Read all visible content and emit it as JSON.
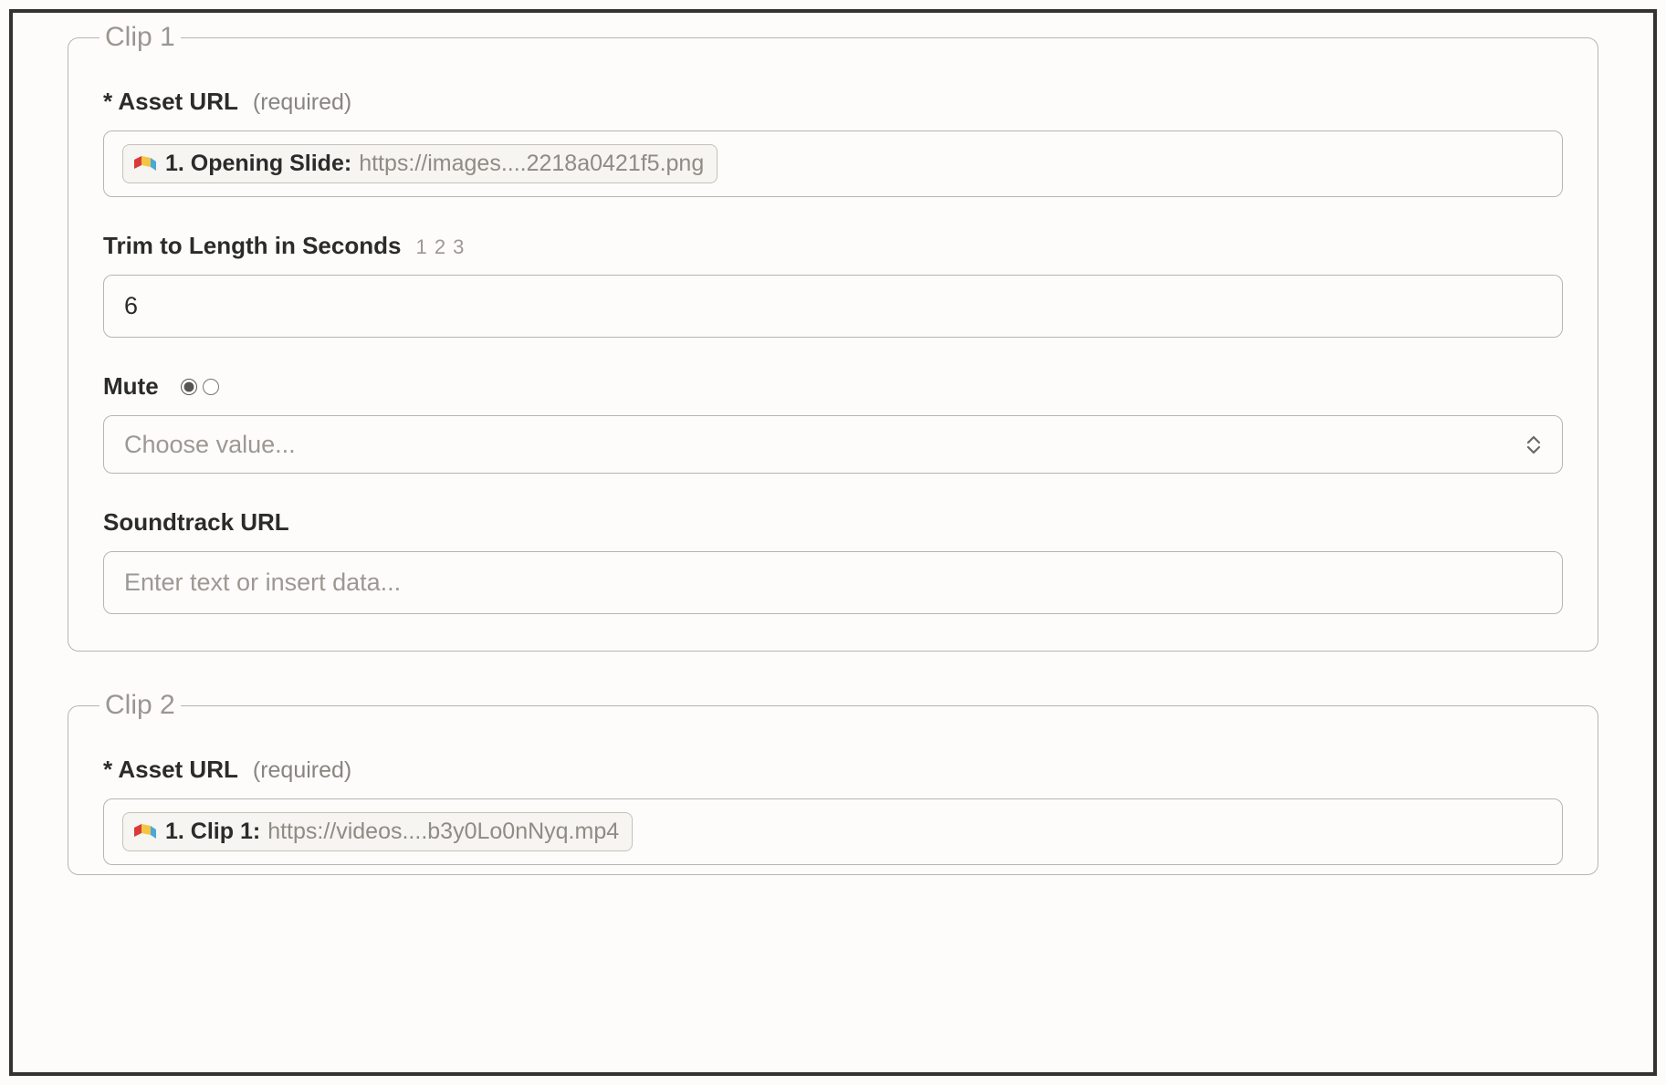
{
  "clips": [
    {
      "legend": "Clip 1",
      "assetUrl": {
        "label": "Asset URL",
        "requiredMark": "*",
        "requiredHint": "(required)",
        "tokenLabel": "1. Opening Slide:",
        "tokenValue": "https://images....2218a0421f5.png"
      },
      "trimLength": {
        "label": "Trim to Length in Seconds",
        "hint": "1 2 3",
        "value": "6"
      },
      "mute": {
        "label": "Mute",
        "placeholder": "Choose value..."
      },
      "soundtrack": {
        "label": "Soundtrack URL",
        "placeholder": "Enter text or insert data..."
      }
    },
    {
      "legend": "Clip 2",
      "assetUrl": {
        "label": "Asset URL",
        "requiredMark": "*",
        "requiredHint": "(required)",
        "tokenLabel": "1. Clip 1:",
        "tokenValue": "https://videos....b3y0Lo0nNyq.mp4"
      }
    }
  ]
}
